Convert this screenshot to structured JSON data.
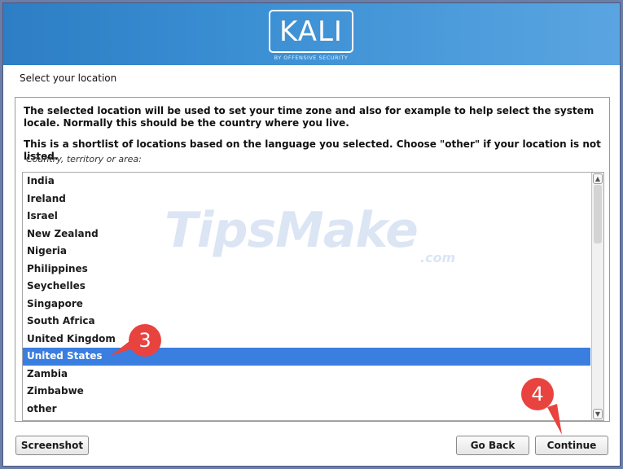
{
  "header": {
    "logo": "KALI",
    "logo_subtitle": "BY OFFENSIVE SECURITY"
  },
  "page": {
    "title": "Select your location",
    "description_1": "The selected location will be used to set your time zone and also for example to help select the system locale. Normally this should be the country where you live.",
    "description_2": "This is a shortlist of locations based on the language you selected. Choose \"other\" if your location is not listed.",
    "list_label": "Country, territory or area:"
  },
  "locations": [
    "India",
    "Ireland",
    "Israel",
    "New Zealand",
    "Nigeria",
    "Philippines",
    "Seychelles",
    "Singapore",
    "South Africa",
    "United Kingdom",
    "United States",
    "Zambia",
    "Zimbabwe",
    "other"
  ],
  "selected_location": "United States",
  "buttons": {
    "screenshot": "Screenshot",
    "go_back": "Go Back",
    "continue": "Continue"
  },
  "watermark": {
    "main": "TipsMake",
    "suffix": ".com"
  },
  "annotations": {
    "step_3": "3",
    "step_4": "4"
  },
  "colors": {
    "banner": "#3b8fd3",
    "selection": "#3a7ee0",
    "annotation": "#e8433f"
  },
  "icons": {
    "scroll_up": "scroll-up-arrow-icon",
    "scroll_down": "scroll-down-arrow-icon"
  }
}
